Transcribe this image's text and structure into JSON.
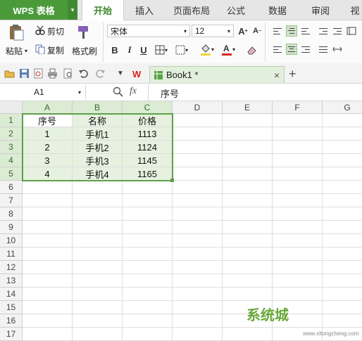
{
  "app": {
    "name": "WPS 表格",
    "dropdown_glyph": "▾"
  },
  "tabs": [
    {
      "label": "开始",
      "active": true
    },
    {
      "label": "插入",
      "active": false
    },
    {
      "label": "页面布局",
      "active": false
    },
    {
      "label": "公式",
      "active": false
    },
    {
      "label": "数据",
      "active": false
    },
    {
      "label": "审阅",
      "active": false
    },
    {
      "label": "视",
      "active": false
    }
  ],
  "ribbon": {
    "paste_label": "粘贴",
    "cut_label": "剪切",
    "copy_label": "复制",
    "format_painter_label": "格式刷",
    "font_name": "宋体",
    "font_size": "12",
    "bold": "B",
    "italic": "I",
    "underline": "U",
    "grow_font": "A",
    "shrink_font": "A"
  },
  "quickbar": {
    "doc_tab_label": "Book1 *",
    "close_glyph": "×",
    "new_tab_glyph": "+"
  },
  "formula_bar": {
    "cell_ref": "A1",
    "fx_label": "fx",
    "content": "序号"
  },
  "grid": {
    "columns": [
      "A",
      "B",
      "C",
      "D",
      "E",
      "F",
      "G"
    ],
    "rows": [
      "1",
      "2",
      "3",
      "4",
      "5",
      "6",
      "7",
      "8",
      "9",
      "10",
      "11",
      "12",
      "13",
      "14",
      "15",
      "16",
      "17"
    ],
    "cells": [
      [
        "序号",
        "名称",
        "价格"
      ],
      [
        "1",
        "手机1",
        "1113"
      ],
      [
        "2",
        "手机2",
        "1124"
      ],
      [
        "3",
        "手机3",
        "1145"
      ],
      [
        "4",
        "手机4",
        "1165"
      ]
    ]
  },
  "watermark": {
    "text": "系统城",
    "url": "www.xitongcheng.com"
  },
  "colors": {
    "accent": "#4a9a3a",
    "selection": "#5e9f4c",
    "highlight": "#e6f1e0"
  }
}
